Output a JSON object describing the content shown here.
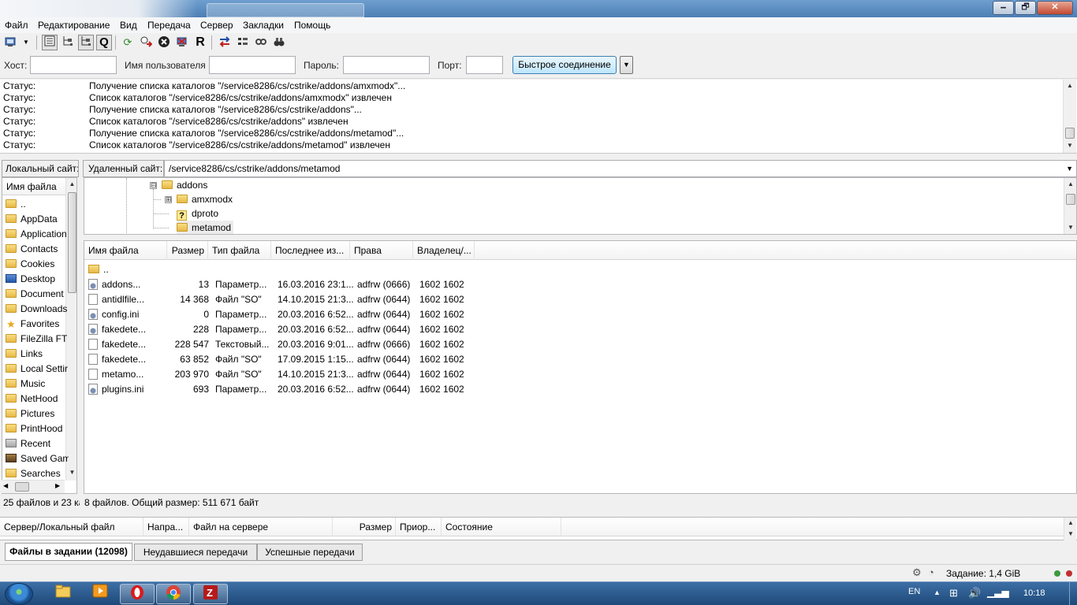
{
  "window": {
    "minimize_glyph": "🗕",
    "maximize_glyph": "🗗",
    "close_glyph": "✕"
  },
  "menu": [
    {
      "label": "Файл"
    },
    {
      "label": "Редактирование"
    },
    {
      "label": "Вид"
    },
    {
      "label": "Передача"
    },
    {
      "label": "Сервер"
    },
    {
      "label": "Закладки"
    },
    {
      "label": "Помощь"
    }
  ],
  "toolbar": {
    "icons": [
      "site-manager-icon",
      "dropdown-arrow-icon",
      "toggle-log-icon",
      "toggle-local-tree-icon",
      "toggle-remote-tree-icon",
      "toggle-queue-icon",
      "refresh-icon",
      "process-queue-icon",
      "cancel-icon",
      "disconnect-icon",
      "reconnect-icon",
      "compare-icon",
      "sync-browse-icon",
      "filter-icon",
      "search-remote-icon"
    ]
  },
  "quickconnect": {
    "host_label": "Хост:",
    "host_value": "",
    "user_label": "Имя пользователя",
    "user_value": "",
    "pass_label": "Пароль:",
    "pass_value": "",
    "port_label": "Порт:",
    "port_value": "",
    "connect_label": "Быстрое соединение",
    "dropdown_glyph": "▼"
  },
  "log": [
    {
      "label": "Статус:",
      "msg": "Получение списка каталогов \"/service8286/cs/cstrike/addons/amxmodx\"..."
    },
    {
      "label": "Статус:",
      "msg": "Список каталогов \"/service8286/cs/cstrike/addons/amxmodx\" извлечен"
    },
    {
      "label": "Статус:",
      "msg": "Получение списка каталогов \"/service8286/cs/cstrike/addons\"..."
    },
    {
      "label": "Статус:",
      "msg": "Список каталогов \"/service8286/cs/cstrike/addons\" извлечен"
    },
    {
      "label": "Статус:",
      "msg": "Получение списка каталогов \"/service8286/cs/cstrike/addons/metamod\"..."
    },
    {
      "label": "Статус:",
      "msg": "Список каталогов \"/service8286/cs/cstrike/addons/metamod\" извлечен"
    }
  ],
  "local": {
    "site_label": "Локальный сайт:",
    "column": "Имя файла",
    "items": [
      {
        "name": "..",
        "icon": "folder"
      },
      {
        "name": "AppData",
        "icon": "folder"
      },
      {
        "name": "Application",
        "icon": "folder"
      },
      {
        "name": "Contacts",
        "icon": "folder"
      },
      {
        "name": "Cookies",
        "icon": "folder"
      },
      {
        "name": "Desktop",
        "icon": "desktop"
      },
      {
        "name": "Document",
        "icon": "folder"
      },
      {
        "name": "Downloads",
        "icon": "folder"
      },
      {
        "name": "Favorites",
        "icon": "star"
      },
      {
        "name": "FileZilla FT",
        "icon": "folder"
      },
      {
        "name": "Links",
        "icon": "folder"
      },
      {
        "name": "Local Settir",
        "icon": "folder"
      },
      {
        "name": "Music",
        "icon": "folder"
      },
      {
        "name": "NetHood",
        "icon": "folder"
      },
      {
        "name": "Pictures",
        "icon": "folder"
      },
      {
        "name": "PrintHood",
        "icon": "folder"
      },
      {
        "name": "Recent",
        "icon": "recent"
      },
      {
        "name": "Saved Gam",
        "icon": "saved"
      },
      {
        "name": "Searches",
        "icon": "search"
      }
    ],
    "status": "25 файлов и 23 ка"
  },
  "remote": {
    "site_label": "Удаленный сайт:",
    "path": "/service8286/cs/cstrike/addons/metamod",
    "tree": [
      {
        "name": "addons",
        "toggle": "⊟"
      },
      {
        "name": "amxmodx",
        "toggle": "⊞"
      },
      {
        "name": "dproto",
        "toggle": ""
      },
      {
        "name": "metamod",
        "toggle": ""
      }
    ],
    "columns": [
      "Имя файла",
      "Размер",
      "Тип файла",
      "Последнее из...",
      "Права",
      "Владелец/..."
    ],
    "files": [
      {
        "name": "..",
        "size": "",
        "type": "",
        "modified": "",
        "perms": "",
        "owner": "",
        "icon": "folder"
      },
      {
        "name": "addons...",
        "size": "13",
        "type": "Параметр...",
        "modified": "16.03.2016 23:1...",
        "perms": "adfrw (0666)",
        "owner": "1602 1602",
        "icon": "gear"
      },
      {
        "name": "antidlfile...",
        "size": "14 368",
        "type": "Файл \"SO\"",
        "modified": "14.10.2015 21:3...",
        "perms": "adfrw (0644)",
        "owner": "1602 1602",
        "icon": "file"
      },
      {
        "name": "config.ini",
        "size": "0",
        "type": "Параметр...",
        "modified": "20.03.2016 6:52...",
        "perms": "adfrw (0644)",
        "owner": "1602 1602",
        "icon": "gear"
      },
      {
        "name": "fakedete...",
        "size": "228",
        "type": "Параметр...",
        "modified": "20.03.2016 6:52...",
        "perms": "adfrw (0644)",
        "owner": "1602 1602",
        "icon": "gear"
      },
      {
        "name": "fakedete...",
        "size": "228 547",
        "type": "Текстовый...",
        "modified": "20.03.2016 9:01...",
        "perms": "adfrw (0666)",
        "owner": "1602 1602",
        "icon": "file"
      },
      {
        "name": "fakedete...",
        "size": "63 852",
        "type": "Файл \"SO\"",
        "modified": "17.09.2015 1:15...",
        "perms": "adfrw (0644)",
        "owner": "1602 1602",
        "icon": "file"
      },
      {
        "name": "metamo...",
        "size": "203 970",
        "type": "Файл \"SO\"",
        "modified": "14.10.2015 21:3...",
        "perms": "adfrw (0644)",
        "owner": "1602 1602",
        "icon": "file"
      },
      {
        "name": "plugins.ini",
        "size": "693",
        "type": "Параметр...",
        "modified": "20.03.2016 6:52...",
        "perms": "adfrw (0644)",
        "owner": "1602 1602",
        "icon": "gear"
      }
    ],
    "status": "8 файлов. Общий размер: 511 671 байт"
  },
  "queue": {
    "columns": [
      "Сервер/Локальный файл",
      "Напра...",
      "Файл на сервере",
      "Размер",
      "Приор...",
      "Состояние"
    ]
  },
  "tabs": [
    {
      "label": "Файлы в задании (12098)",
      "active": true
    },
    {
      "label": "Неудавшиеся передачи",
      "active": false
    },
    {
      "label": "Успешные передачи",
      "active": false
    }
  ],
  "statusbar": {
    "queue_text": "Задание: 1,4 GiB"
  },
  "taskbar": {
    "language": "EN",
    "time": "10:18",
    "apps": [
      "explorer-icon",
      "media-player-icon",
      "opera-icon",
      "chrome-icon",
      "filezilla-icon"
    ]
  },
  "colors": {
    "titlebar": "#4d7fb5",
    "taskbar": "#1e4979",
    "quick_connect": "#bee6fd",
    "folder": "#e7b945"
  }
}
